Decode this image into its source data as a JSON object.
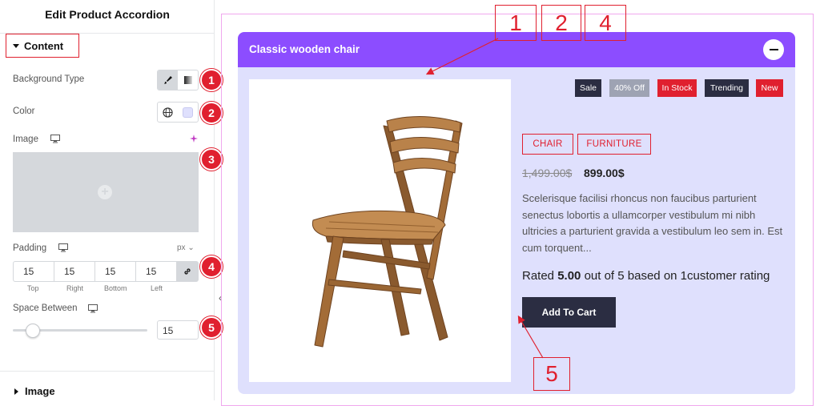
{
  "panel": {
    "title": "Edit Product Accordion",
    "content_section": "Content",
    "image_section": "Image",
    "background_type_label": "Background Type",
    "color_label": "Color",
    "image_label": "Image",
    "padding_label": "Padding",
    "padding_unit": "px",
    "padding_values": {
      "top": "15",
      "right": "15",
      "bottom": "15",
      "left": "15"
    },
    "padding_labels": {
      "top": "Top",
      "right": "Right",
      "bottom": "Bottom",
      "left": "Left"
    },
    "space_between_label": "Space Between",
    "space_between_value": "15"
  },
  "badges": [
    "1",
    "2",
    "3",
    "4",
    "5"
  ],
  "callouts": [
    "1",
    "2",
    "4",
    "5"
  ],
  "accordion": {
    "title": "Classic wooden chair",
    "tags": [
      "Sale",
      "40% Off",
      "In Stock",
      "Trending",
      "New"
    ],
    "categories": [
      "CHAIR",
      "FURNITURE"
    ],
    "old_price": "1,499.00$",
    "price": "899.00$",
    "description": "Scelerisque facilisi rhoncus non faucibus parturient senectus lobortis a ullamcorper vestibulum mi nibh ultricies a parturient gravida a vestibulum leo sem in. Est cum torquent...",
    "rating_prefix": "Rated ",
    "rating_value": "5.00",
    "rating_suffix": " out of 5 based on 1customer rating",
    "cart_label": "Add To Cart"
  },
  "colors": {
    "accent": "#8c4dff",
    "body_bg": "#dfe0fd",
    "annotation": "#e0202f",
    "dark": "#2b2d42"
  }
}
